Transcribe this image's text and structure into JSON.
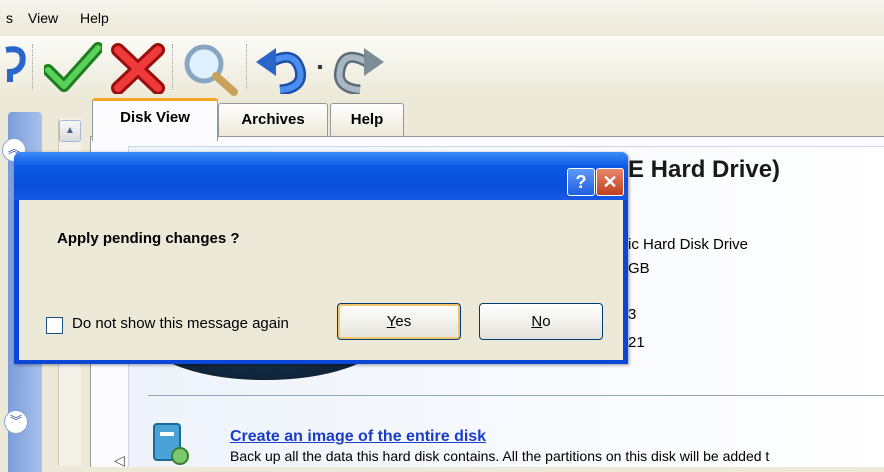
{
  "menu": {
    "cut_item": "s",
    "view": "View",
    "help": "Help"
  },
  "tabs": [
    {
      "label": "Disk View",
      "active": true
    },
    {
      "label": "Archives",
      "active": false
    },
    {
      "label": "Help",
      "active": false
    }
  ],
  "background": {
    "title_fragment": "E Hard Drive)",
    "line1": "ic Hard Disk Drive",
    "line2": "GB",
    "line3": "3",
    "line4": "21",
    "link": "Create an image of the entire disk",
    "desc": "Back up all the data this hard disk contains. All the partitions on this disk will be added t"
  },
  "icons": {
    "toolbar": [
      "wizard-icon",
      "apply-checkmark-icon",
      "discard-x-icon",
      "search-magnifier-icon",
      "undo-icon",
      "undo-dropdown-icon",
      "redo-icon"
    ],
    "colors": {
      "apply": "#2fa12f",
      "discard": "#d11b1b",
      "undo": "#2a66c9",
      "redo": "#8a9aa5"
    }
  },
  "dialog": {
    "help_glyph": "?",
    "close_glyph": "✕",
    "message": "Apply pending changes ?",
    "checkbox_label": "Do not show this message again",
    "checkbox_checked": false,
    "yes_label": "Yes",
    "no_label": "No"
  }
}
